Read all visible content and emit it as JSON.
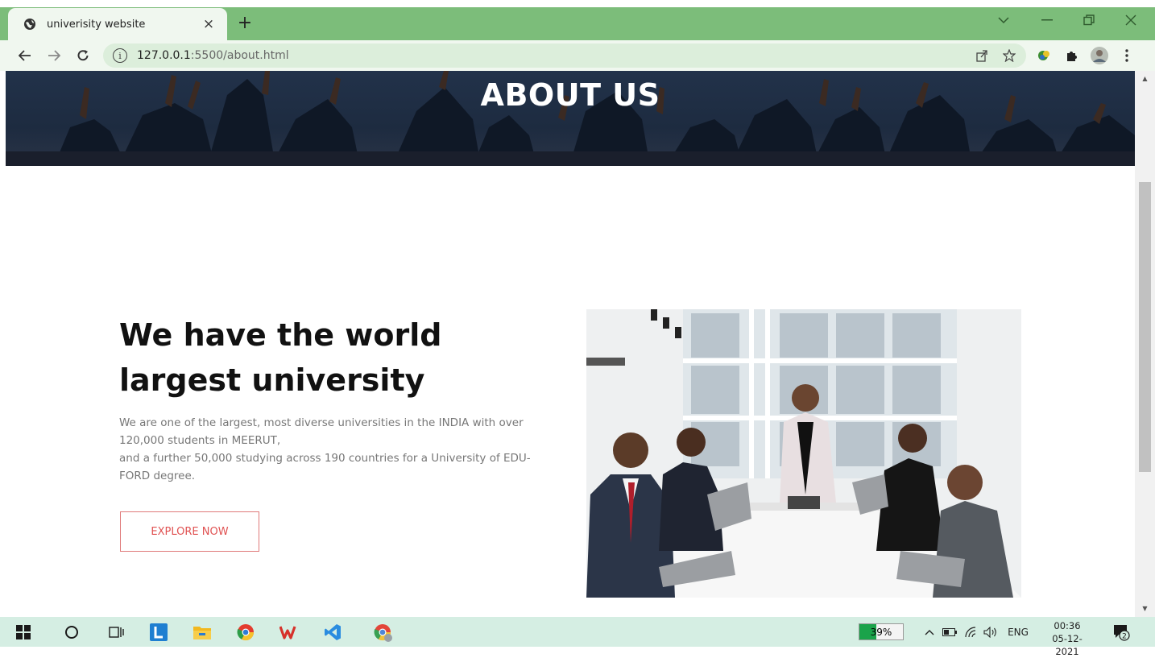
{
  "browser": {
    "tab_title": "univerisity website",
    "tab_close": "×",
    "new_tab": "+",
    "url_host": "127.0.0.1",
    "url_rest": ":5500/about.html",
    "colors": {
      "frame": "#7cbd7a",
      "toolbar": "#f0f7ef",
      "omnibox": "#dceedb"
    }
  },
  "page": {
    "hero_title": "ABOUT US",
    "heading": "We have the world largest university",
    "paragraph_line1": "We are one of the largest, most diverse universities in the INDIA with over 120,000 students in MEERUT,",
    "paragraph_line2": "and a further 50,000 studying across 190 countries for a University of EDU-FORD degree.",
    "button_label": "EXPLORE NOW",
    "colors": {
      "button_border": "#e07a7a",
      "button_text": "#e05252",
      "heading": "#111111",
      "body_text": "#777777"
    }
  },
  "taskbar": {
    "battery_percent": "39%",
    "battery_level": 0.39,
    "language": "ENG",
    "time": "00:36",
    "date": "05-12-2021",
    "notifications": "2"
  }
}
